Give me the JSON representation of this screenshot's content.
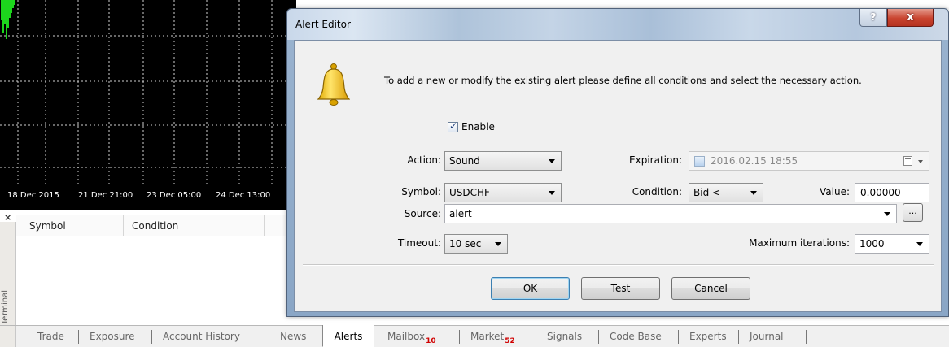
{
  "chart": {
    "time_labels": [
      "18 Dec 2015",
      "21 Dec 21:00",
      "23 Dec 05:00",
      "24 Dec 13:00"
    ]
  },
  "terminal": {
    "side_label": "Terminal",
    "columns": [
      "Symbol",
      "Condition"
    ]
  },
  "tabs": [
    {
      "label": "Trade"
    },
    {
      "label": "Exposure"
    },
    {
      "label": "Account History"
    },
    {
      "label": "News"
    },
    {
      "label": "Alerts",
      "active": true
    },
    {
      "label": "Mailbox",
      "badge": "10"
    },
    {
      "label": "Market",
      "badge": "52"
    },
    {
      "label": "Signals"
    },
    {
      "label": "Code Base"
    },
    {
      "label": "Experts"
    },
    {
      "label": "Journal"
    }
  ],
  "dialog": {
    "title": "Alert Editor",
    "help_label": "?",
    "close_label": "x",
    "intro": "To add a new or modify the existing alert please define all conditions and select the necessary action.",
    "enable": {
      "label": "Enable",
      "checked": true
    },
    "action": {
      "label": "Action:",
      "value": "Sound"
    },
    "expiration": {
      "label": "Expiration:",
      "value": "2016.02.15 18:55"
    },
    "symbol": {
      "label": "Symbol:",
      "value": "USDCHF"
    },
    "condition": {
      "label": "Condition:",
      "value": "Bid <"
    },
    "value_field": {
      "label": "Value:",
      "value": "0.00000"
    },
    "source": {
      "label": "Source:",
      "value": "alert",
      "browse_label": "..."
    },
    "timeout": {
      "label": "Timeout:",
      "value": "10 sec"
    },
    "max_iterations": {
      "label": "Maximum iterations:",
      "value": "1000"
    },
    "buttons": {
      "ok": "OK",
      "test": "Test",
      "cancel": "Cancel"
    }
  },
  "colors": {
    "chart_bg": "#000000",
    "chart_grid": "#d0d0d0",
    "chart_series": "#1dd61d",
    "badge": "#d00000",
    "close_button": "#c9442f",
    "bell": "#f2c51c"
  }
}
